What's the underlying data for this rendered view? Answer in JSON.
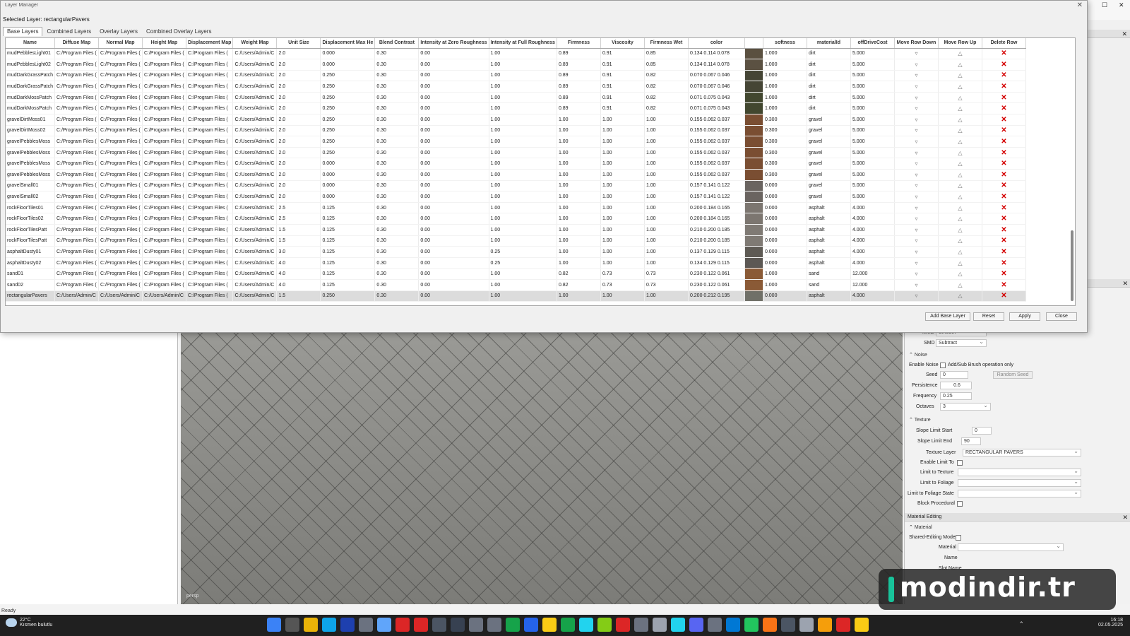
{
  "dialog": {
    "title": "Layer Manager",
    "selected_layer_label": "Selected Layer: rectangularPavers",
    "tabs": [
      "Base Layers",
      "Combined Layers",
      "Overlay Layers",
      "Combined Overlay Layers"
    ],
    "active_tab": 0,
    "buttons": {
      "add": "Add Base Layer",
      "reset": "Reset",
      "apply": "Apply",
      "close": "Close"
    }
  },
  "grid": {
    "columns": [
      "Name",
      "Diffuse Map",
      "Normal Map",
      "Height Map",
      "Displacement Map",
      "Weight Map",
      "Unit Size",
      "Displacement Max He",
      "Blend Contrast",
      "Intensity at Zero Roughness",
      "Intensity at Full Roughness",
      "Firmness",
      "Viscosity",
      "Firmness Wet",
      "color",
      "",
      "softness",
      "materialId",
      "offDriveCost",
      "Move Row Down",
      "Move Row Up",
      "Delete Row"
    ],
    "rows": [
      [
        "mudPebblesLight01",
        "C:/Program Files (",
        "C:/Program Files (",
        "C:/Program Files (",
        "C:/Program Files (",
        "C:/Users/Admin/C",
        "2.0",
        "0.000",
        "0.30",
        "0.00",
        "1.00",
        "0.89",
        "0.91",
        "0.85",
        "0.134 0.114 0.078",
        "#5a5040",
        "1.000",
        "dirt",
        "5.000"
      ],
      [
        "mudPebblesLight02",
        "C:/Program Files (",
        "C:/Program Files (",
        "C:/Program Files (",
        "C:/Program Files (",
        "C:/Users/Admin/C",
        "2.0",
        "0.000",
        "0.30",
        "0.00",
        "1.00",
        "0.89",
        "0.91",
        "0.85",
        "0.134 0.114 0.078",
        "#5b5142",
        "1.000",
        "dirt",
        "5.000"
      ],
      [
        "mudDarkGrassPatch",
        "C:/Program Files (",
        "C:/Program Files (",
        "C:/Program Files (",
        "C:/Program Files (",
        "C:/Users/Admin/C",
        "2.0",
        "0.250",
        "0.30",
        "0.00",
        "1.00",
        "0.89",
        "0.91",
        "0.82",
        "0.070 0.067 0.046",
        "#454535",
        "1.000",
        "dirt",
        "5.000"
      ],
      [
        "mudDarkGrassPatch",
        "C:/Program Files (",
        "C:/Program Files (",
        "C:/Program Files (",
        "C:/Program Files (",
        "C:/Users/Admin/C",
        "2.0",
        "0.250",
        "0.30",
        "0.00",
        "1.00",
        "0.89",
        "0.91",
        "0.82",
        "0.070 0.067 0.046",
        "#454535",
        "1.000",
        "dirt",
        "5.000"
      ],
      [
        "mudDarkMossPatch",
        "C:/Program Files (",
        "C:/Program Files (",
        "C:/Program Files (",
        "C:/Program Files (",
        "C:/Users/Admin/C",
        "2.0",
        "0.250",
        "0.30",
        "0.00",
        "1.00",
        "0.89",
        "0.91",
        "0.82",
        "0.071 0.075 0.043",
        "#42472f",
        "1.000",
        "dirt",
        "5.000"
      ],
      [
        "mudDarkMossPatch",
        "C:/Program Files (",
        "C:/Program Files (",
        "C:/Program Files (",
        "C:/Program Files (",
        "C:/Users/Admin/C",
        "2.0",
        "0.250",
        "0.30",
        "0.00",
        "1.00",
        "0.89",
        "0.91",
        "0.82",
        "0.071 0.075 0.043",
        "#42472f",
        "1.000",
        "dirt",
        "5.000"
      ],
      [
        "gravelDirtMoss01",
        "C:/Program Files (",
        "C:/Program Files (",
        "C:/Program Files (",
        "C:/Program Files (",
        "C:/Users/Admin/C",
        "2.0",
        "0.250",
        "0.30",
        "0.00",
        "1.00",
        "1.00",
        "1.00",
        "1.00",
        "0.155 0.062 0.037",
        "#7a4e32",
        "0.300",
        "gravel",
        "5.000"
      ],
      [
        "gravelDirtMoss02",
        "C:/Program Files (",
        "C:/Program Files (",
        "C:/Program Files (",
        "C:/Program Files (",
        "C:/Users/Admin/C",
        "2.0",
        "0.250",
        "0.30",
        "0.00",
        "1.00",
        "1.00",
        "1.00",
        "1.00",
        "0.155 0.062 0.037",
        "#7a4e32",
        "0.300",
        "gravel",
        "5.000"
      ],
      [
        "gravelPebblesMoss",
        "C:/Program Files (",
        "C:/Program Files (",
        "C:/Program Files (",
        "C:/Program Files (",
        "C:/Users/Admin/C",
        "2.0",
        "0.250",
        "0.30",
        "0.00",
        "1.00",
        "1.00",
        "1.00",
        "1.00",
        "0.155 0.062 0.037",
        "#7a4e32",
        "0.300",
        "gravel",
        "5.000"
      ],
      [
        "gravelPebblesMoss",
        "C:/Program Files (",
        "C:/Program Files (",
        "C:/Program Files (",
        "C:/Program Files (",
        "C:/Users/Admin/C",
        "2.0",
        "0.250",
        "0.30",
        "0.00",
        "1.00",
        "1.00",
        "1.00",
        "1.00",
        "0.155 0.062 0.037",
        "#7a4e32",
        "0.300",
        "gravel",
        "5.000"
      ],
      [
        "gravelPebblesMoss",
        "C:/Program Files (",
        "C:/Program Files (",
        "C:/Program Files (",
        "C:/Program Files (",
        "C:/Users/Admin/C",
        "2.0",
        "0.000",
        "0.30",
        "0.00",
        "1.00",
        "1.00",
        "1.00",
        "1.00",
        "0.155 0.062 0.037",
        "#7a4e32",
        "0.300",
        "gravel",
        "5.000"
      ],
      [
        "gravelPebblesMoss",
        "C:/Program Files (",
        "C:/Program Files (",
        "C:/Program Files (",
        "C:/Program Files (",
        "C:/Users/Admin/C",
        "2.0",
        "0.000",
        "0.30",
        "0.00",
        "1.00",
        "1.00",
        "1.00",
        "1.00",
        "0.155 0.062 0.037",
        "#7a4e32",
        "0.300",
        "gravel",
        "5.000"
      ],
      [
        "gravelSmall01",
        "C:/Program Files (",
        "C:/Program Files (",
        "C:/Program Files (",
        "C:/Program Files (",
        "C:/Users/Admin/C",
        "2.0",
        "0.000",
        "0.30",
        "0.00",
        "1.00",
        "1.00",
        "1.00",
        "1.00",
        "0.157 0.141 0.122",
        "#6a6460",
        "0.000",
        "gravel",
        "5.000"
      ],
      [
        "gravelSmall02",
        "C:/Program Files (",
        "C:/Program Files (",
        "C:/Program Files (",
        "C:/Program Files (",
        "C:/Users/Admin/C",
        "2.0",
        "0.000",
        "0.30",
        "0.00",
        "1.00",
        "1.00",
        "1.00",
        "1.00",
        "0.157 0.141 0.122",
        "#6a6460",
        "0.000",
        "gravel",
        "5.000"
      ],
      [
        "rockFloorTiles01",
        "C:/Program Files (",
        "C:/Program Files (",
        "C:/Program Files (",
        "C:/Program Files (",
        "C:/Users/Admin/C",
        "2.5",
        "0.125",
        "0.30",
        "0.00",
        "1.00",
        "1.00",
        "1.00",
        "1.00",
        "0.200 0.184 0.165",
        "#7c7670",
        "0.000",
        "asphalt",
        "4.000"
      ],
      [
        "rockFloorTiles02",
        "C:/Program Files (",
        "C:/Program Files (",
        "C:/Program Files (",
        "C:/Program Files (",
        "C:/Users/Admin/C",
        "2.5",
        "0.125",
        "0.30",
        "0.00",
        "1.00",
        "1.00",
        "1.00",
        "1.00",
        "0.200 0.184 0.165",
        "#7c7670",
        "0.000",
        "asphalt",
        "4.000"
      ],
      [
        "rockFloorTilesPatt",
        "C:/Program Files (",
        "C:/Program Files (",
        "C:/Program Files (",
        "C:/Program Files (",
        "C:/Users/Admin/C",
        "1.5",
        "0.125",
        "0.30",
        "0.00",
        "1.00",
        "1.00",
        "1.00",
        "1.00",
        "0.210 0.200 0.185",
        "#7f7a74",
        "0.000",
        "asphalt",
        "4.000"
      ],
      [
        "rockFloorTilesPatt",
        "C:/Program Files (",
        "C:/Program Files (",
        "C:/Program Files (",
        "C:/Program Files (",
        "C:/Users/Admin/C",
        "1.5",
        "0.125",
        "0.30",
        "0.00",
        "1.00",
        "1.00",
        "1.00",
        "1.00",
        "0.210 0.200 0.185",
        "#7f7a74",
        "0.000",
        "asphalt",
        "4.000"
      ],
      [
        "asphaltDusty01",
        "C:/Program Files (",
        "C:/Program Files (",
        "C:/Program Files (",
        "C:/Program Files (",
        "C:/Users/Admin/C",
        "3.0",
        "0.125",
        "0.30",
        "0.00",
        "0.25",
        "1.00",
        "1.00",
        "1.00",
        "0.137 0.129 0.115",
        "#5e5a54",
        "0.000",
        "asphalt",
        "4.000"
      ],
      [
        "asphaltDusty02",
        "C:/Program Files (",
        "C:/Program Files (",
        "C:/Program Files (",
        "C:/Program Files (",
        "C:/Users/Admin/C",
        "4.0",
        "0.125",
        "0.30",
        "0.00",
        "0.25",
        "1.00",
        "1.00",
        "1.00",
        "0.134 0.129 0.115",
        "#5c5854",
        "0.000",
        "asphalt",
        "4.000"
      ],
      [
        "sand01",
        "C:/Program Files (",
        "C:/Program Files (",
        "C:/Program Files (",
        "C:/Program Files (",
        "C:/Users/Admin/C",
        "4.0",
        "0.125",
        "0.30",
        "0.00",
        "1.00",
        "0.82",
        "0.73",
        "0.73",
        "0.230 0.122 0.061",
        "#8a5a36",
        "1.000",
        "sand",
        "12.000"
      ],
      [
        "sand02",
        "C:/Program Files (",
        "C:/Program Files (",
        "C:/Program Files (",
        "C:/Program Files (",
        "C:/Users/Admin/C",
        "4.0",
        "0.125",
        "0.30",
        "0.00",
        "1.00",
        "0.82",
        "0.73",
        "0.73",
        "0.230 0.122 0.061",
        "#8a5a36",
        "1.000",
        "sand",
        "12.000"
      ],
      [
        "rectangularPavers",
        "C:/Users/Admin/C",
        "C:/Users/Admin/C",
        "C:/Users/Admin/C",
        "C:/Program Files (",
        "C:/Users/Admin/C",
        "1.5",
        "0.250",
        "0.30",
        "0.00",
        "1.00",
        "1.00",
        "1.00",
        "1.00",
        "0.200 0.212 0.195",
        "#707068",
        "0.000",
        "asphalt",
        "4.000"
      ]
    ],
    "selected_row": 22,
    "move_down_icon": "▿",
    "move_up_icon": "△",
    "delete_icon": "✕"
  },
  "right_panel": {
    "mme_label": "MME",
    "mme_value": "Smooth",
    "smd_label": "SMD",
    "smd_value": "Subtract",
    "noise_section": "Noise",
    "enable_noise_label": "Enable Noise",
    "enable_noise_note": "Add/Sub Brush operation only",
    "seed_label": "Seed",
    "seed_value": "0",
    "random_seed_button": "Random Seed",
    "persistence_label": "Persistence",
    "persistence_value": "0.6",
    "frequency_label": "Frequency",
    "frequency_value": "0.25",
    "octaves_label": "Octaves",
    "octaves_value": "3",
    "texture_section": "Texture",
    "slope_start_label": "Slope Limit Start",
    "slope_start_value": "0",
    "slope_end_label": "Slope Limit End",
    "slope_end_value": "90",
    "texture_layer_label": "Texture Layer",
    "texture_layer_value": "RECTANGULAR PAVERS",
    "enable_limit_label": "Enable Limit To",
    "limit_texture_label": "Limit to Texture",
    "limit_foliage_label": "Limit to Foliage",
    "limit_foliage_state_label": "Limit to Foliage State",
    "block_procedural_label": "Block Procedural",
    "material_editing_header": "Material Editing",
    "material_section": "Material",
    "shared_editing_label": "Shared-Editing Mode",
    "material_label": "Material",
    "name_label": "Name",
    "slot_name_label": "Slot Name"
  },
  "viewport": {
    "label": "persp"
  },
  "status": {
    "text": "Ready"
  },
  "taskbar": {
    "temperature": "22°C",
    "weather_text": "Kısmen bulutlu",
    "time": "16:18",
    "date": "02.05.2025",
    "icon_colors": [
      "#3b82f6",
      "#555",
      "#eab308",
      "#0ea5e9",
      "#1e40af",
      "#6b7280",
      "#60a5fa",
      "#dc2626",
      "#dc2626",
      "#4b5563",
      "#374151",
      "#6b7280",
      "#6b7280",
      "#16a34a",
      "#2563eb",
      "#facc15",
      "#16a34a",
      "#22d3ee",
      "#84cc16",
      "#dc2626",
      "#6b7280",
      "#9ca3af",
      "#22d3ee",
      "#5865f2",
      "#6b7280",
      "#0078d4",
      "#22c55e",
      "#f97316",
      "#4b5563",
      "#9ca3af",
      "#f59e0b",
      "#dc2626",
      "#facc15"
    ]
  },
  "watermark": {
    "text": "modindir.tr"
  }
}
